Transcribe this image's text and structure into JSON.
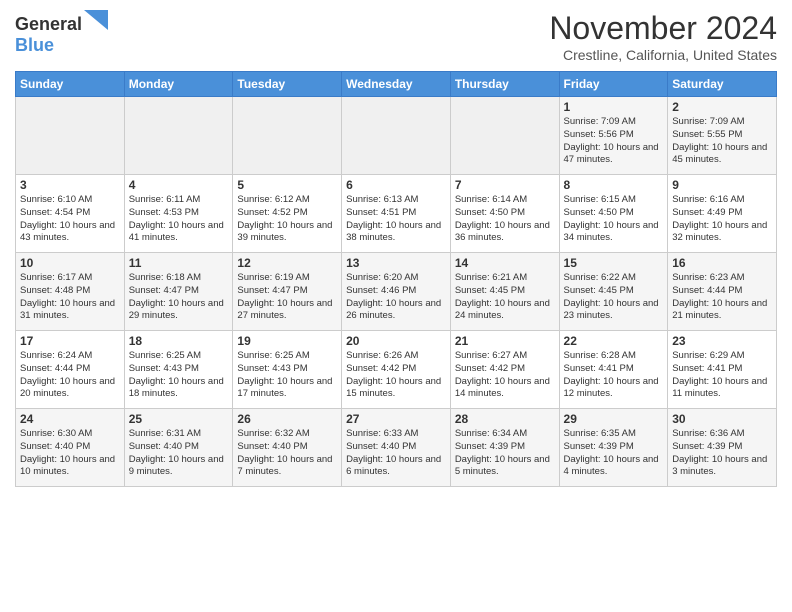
{
  "header": {
    "logo_general": "General",
    "logo_blue": "Blue",
    "month_title": "November 2024",
    "location": "Crestline, California, United States"
  },
  "calendar": {
    "days_of_week": [
      "Sunday",
      "Monday",
      "Tuesday",
      "Wednesday",
      "Thursday",
      "Friday",
      "Saturday"
    ],
    "weeks": [
      [
        {
          "day": "",
          "info": ""
        },
        {
          "day": "",
          "info": ""
        },
        {
          "day": "",
          "info": ""
        },
        {
          "day": "",
          "info": ""
        },
        {
          "day": "",
          "info": ""
        },
        {
          "day": "1",
          "info": "Sunrise: 7:09 AM\nSunset: 5:56 PM\nDaylight: 10 hours\nand 47 minutes."
        },
        {
          "day": "2",
          "info": "Sunrise: 7:09 AM\nSunset: 5:55 PM\nDaylight: 10 hours\nand 45 minutes."
        }
      ],
      [
        {
          "day": "3",
          "info": "Sunrise: 6:10 AM\nSunset: 4:54 PM\nDaylight: 10 hours\nand 43 minutes."
        },
        {
          "day": "4",
          "info": "Sunrise: 6:11 AM\nSunset: 4:53 PM\nDaylight: 10 hours\nand 41 minutes."
        },
        {
          "day": "5",
          "info": "Sunrise: 6:12 AM\nSunset: 4:52 PM\nDaylight: 10 hours\nand 39 minutes."
        },
        {
          "day": "6",
          "info": "Sunrise: 6:13 AM\nSunset: 4:51 PM\nDaylight: 10 hours\nand 38 minutes."
        },
        {
          "day": "7",
          "info": "Sunrise: 6:14 AM\nSunset: 4:50 PM\nDaylight: 10 hours\nand 36 minutes."
        },
        {
          "day": "8",
          "info": "Sunrise: 6:15 AM\nSunset: 4:50 PM\nDaylight: 10 hours\nand 34 minutes."
        },
        {
          "day": "9",
          "info": "Sunrise: 6:16 AM\nSunset: 4:49 PM\nDaylight: 10 hours\nand 32 minutes."
        }
      ],
      [
        {
          "day": "10",
          "info": "Sunrise: 6:17 AM\nSunset: 4:48 PM\nDaylight: 10 hours\nand 31 minutes."
        },
        {
          "day": "11",
          "info": "Sunrise: 6:18 AM\nSunset: 4:47 PM\nDaylight: 10 hours\nand 29 minutes."
        },
        {
          "day": "12",
          "info": "Sunrise: 6:19 AM\nSunset: 4:47 PM\nDaylight: 10 hours\nand 27 minutes."
        },
        {
          "day": "13",
          "info": "Sunrise: 6:20 AM\nSunset: 4:46 PM\nDaylight: 10 hours\nand 26 minutes."
        },
        {
          "day": "14",
          "info": "Sunrise: 6:21 AM\nSunset: 4:45 PM\nDaylight: 10 hours\nand 24 minutes."
        },
        {
          "day": "15",
          "info": "Sunrise: 6:22 AM\nSunset: 4:45 PM\nDaylight: 10 hours\nand 23 minutes."
        },
        {
          "day": "16",
          "info": "Sunrise: 6:23 AM\nSunset: 4:44 PM\nDaylight: 10 hours\nand 21 minutes."
        }
      ],
      [
        {
          "day": "17",
          "info": "Sunrise: 6:24 AM\nSunset: 4:44 PM\nDaylight: 10 hours\nand 20 minutes."
        },
        {
          "day": "18",
          "info": "Sunrise: 6:25 AM\nSunset: 4:43 PM\nDaylight: 10 hours\nand 18 minutes."
        },
        {
          "day": "19",
          "info": "Sunrise: 6:25 AM\nSunset: 4:43 PM\nDaylight: 10 hours\nand 17 minutes."
        },
        {
          "day": "20",
          "info": "Sunrise: 6:26 AM\nSunset: 4:42 PM\nDaylight: 10 hours\nand 15 minutes."
        },
        {
          "day": "21",
          "info": "Sunrise: 6:27 AM\nSunset: 4:42 PM\nDaylight: 10 hours\nand 14 minutes."
        },
        {
          "day": "22",
          "info": "Sunrise: 6:28 AM\nSunset: 4:41 PM\nDaylight: 10 hours\nand 12 minutes."
        },
        {
          "day": "23",
          "info": "Sunrise: 6:29 AM\nSunset: 4:41 PM\nDaylight: 10 hours\nand 11 minutes."
        }
      ],
      [
        {
          "day": "24",
          "info": "Sunrise: 6:30 AM\nSunset: 4:40 PM\nDaylight: 10 hours\nand 10 minutes."
        },
        {
          "day": "25",
          "info": "Sunrise: 6:31 AM\nSunset: 4:40 PM\nDaylight: 10 hours\nand 9 minutes."
        },
        {
          "day": "26",
          "info": "Sunrise: 6:32 AM\nSunset: 4:40 PM\nDaylight: 10 hours\nand 7 minutes."
        },
        {
          "day": "27",
          "info": "Sunrise: 6:33 AM\nSunset: 4:40 PM\nDaylight: 10 hours\nand 6 minutes."
        },
        {
          "day": "28",
          "info": "Sunrise: 6:34 AM\nSunset: 4:39 PM\nDaylight: 10 hours\nand 5 minutes."
        },
        {
          "day": "29",
          "info": "Sunrise: 6:35 AM\nSunset: 4:39 PM\nDaylight: 10 hours\nand 4 minutes."
        },
        {
          "day": "30",
          "info": "Sunrise: 6:36 AM\nSunset: 4:39 PM\nDaylight: 10 hours\nand 3 minutes."
        }
      ]
    ]
  }
}
